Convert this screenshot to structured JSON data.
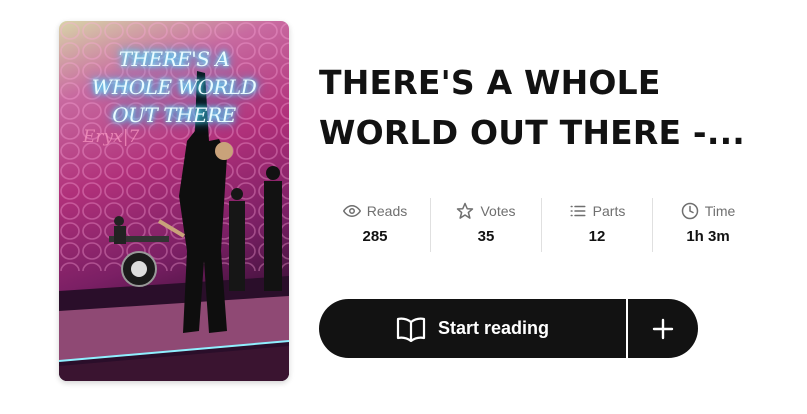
{
  "cover": {
    "title_text": "THERE'S A\nWHOLE WORLD\nOUT THERE",
    "author_text": "Eryx|7"
  },
  "story": {
    "title": "THERE'S A WHOLE WORLD OUT THERE -..."
  },
  "stats": [
    {
      "label": "Reads",
      "value": "285",
      "icon": "eye-icon"
    },
    {
      "label": "Votes",
      "value": "35",
      "icon": "star-icon"
    },
    {
      "label": "Parts",
      "value": "12",
      "icon": "list-icon"
    },
    {
      "label": "Time",
      "value": "1h 3m",
      "icon": "clock-icon"
    }
  ],
  "actions": {
    "start_label": "Start reading",
    "start_icon": "book-open-icon",
    "add_icon": "plus-icon"
  },
  "colors": {
    "button_bg": "#121212",
    "muted_text": "#6f6f6f",
    "title_text": "#121212"
  }
}
